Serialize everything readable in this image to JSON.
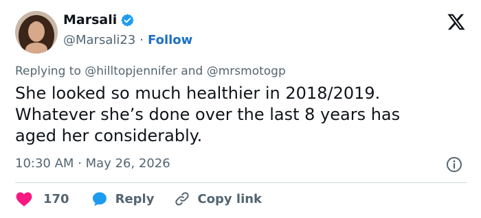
{
  "author": {
    "display_name": "Marsali",
    "handle": "@Marsali23",
    "separator": "·",
    "follow_label": "Follow",
    "verified": true
  },
  "reply": {
    "prefix": "Replying to",
    "mention_1": "@hilltopjennifer",
    "conjunction": "and",
    "mention_2": "@mrsmotogp"
  },
  "tweet": {
    "lines": [
      "She looked so much healthier in 2018/2019.",
      "Whatever she’s done over the last 8 years has",
      "aged her considerably."
    ]
  },
  "meta": {
    "time": "10:30 AM",
    "separator": "·",
    "date": "May 26, 2026"
  },
  "actions": {
    "like_count": "170",
    "reply_label": "Reply",
    "copy_link_label": "Copy link"
  },
  "icons": {
    "logo": "x-logo-icon",
    "verified": "verified-badge-icon",
    "info": "info-icon",
    "like": "heart-icon",
    "reply": "speech-bubble-icon",
    "copy": "link-icon"
  },
  "colors": {
    "accent_blue": "#1d9bf0",
    "follow_blue": "#1d6fc8",
    "heart_pink": "#f91880",
    "secondary_text": "#536471",
    "primary_text": "#0f1419",
    "divider": "#cfd9de"
  }
}
